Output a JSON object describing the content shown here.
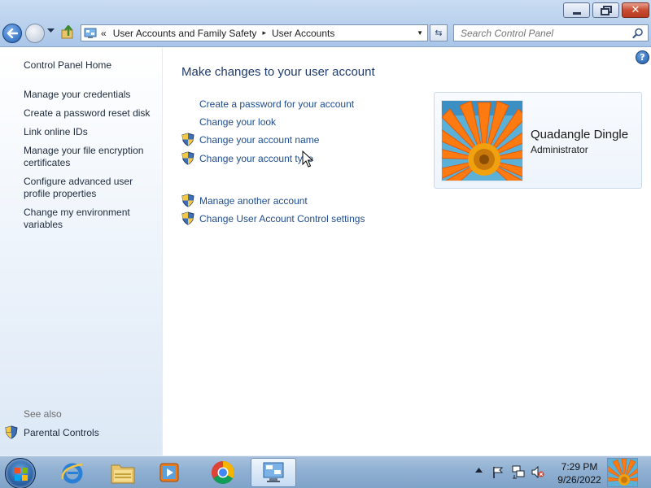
{
  "window": {
    "minimize_glyph": "minimize-icon",
    "maximize_glyph": "maximize-icon",
    "close_label": "✕"
  },
  "address_bar": {
    "overflow_chevron": "«",
    "breadcrumbs": [
      "User Accounts and Family Safety",
      "User Accounts"
    ],
    "separator": "▸"
  },
  "search": {
    "placeholder": "Search Control Panel"
  },
  "sidebar": {
    "home": "Control Panel Home",
    "links": [
      "Manage your credentials",
      "Create a password reset disk",
      "Link online IDs",
      "Manage your file encryption certificates",
      "Configure advanced user profile properties",
      "Change my environment variables"
    ],
    "see_also_heading": "See also",
    "see_also_links": [
      "Parental Controls"
    ]
  },
  "main": {
    "help_label": "?",
    "title": "Make changes to your user account",
    "tasks": [
      {
        "label": "Create a password for your account",
        "shield": false
      },
      {
        "label": "Change your look",
        "shield": false
      },
      {
        "label": "Change your account name",
        "shield": true
      },
      {
        "label": "Change your account type",
        "shield": true
      },
      {
        "label": "Manage another account",
        "shield": true
      },
      {
        "label": "Change User Account Control settings",
        "shield": true
      }
    ]
  },
  "user": {
    "name": "Quadangle Dingle",
    "role": "Administrator"
  },
  "taskbar": {
    "pinned": [
      "internet-explorer-icon",
      "windows-explorer-icon",
      "media-player-icon",
      "chrome-icon",
      "control-panel-icon"
    ],
    "active": "control-panel-icon",
    "tray_icons": [
      "show-hidden-icons-icon",
      "action-center-flag-icon",
      "network-icon",
      "volume-muted-icon"
    ],
    "time": "7:29 PM",
    "date": "9/26/2022"
  },
  "colors": {
    "link": "#1e4c8f",
    "title": "#1e3a6e",
    "sidebar_text": "#1e2b3c",
    "taskbar": "#8fb0d2"
  }
}
